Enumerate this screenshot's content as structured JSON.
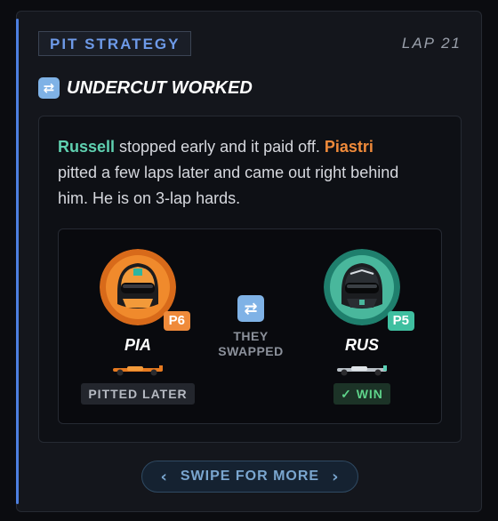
{
  "header": {
    "tag": "PIT STRATEGY",
    "lap": "LAP 21"
  },
  "headline": {
    "icon": "shuffle-icon",
    "glyph": "⇄",
    "text": "UNDERCUT WORKED"
  },
  "story": {
    "driver1": "Russell",
    "text1": " stopped early and it paid off. ",
    "driver2": "Piastri",
    "text2": " pitted a few laps later and came out right behind him. He is on 3-lap hards."
  },
  "swap": {
    "left": {
      "code": "PIA",
      "position": "P6",
      "status": "PITTED LATER",
      "color": "#ef8a3a"
    },
    "middle": {
      "glyph": "⇄",
      "line1": "THEY",
      "line2": "SWAPPED"
    },
    "right": {
      "code": "RUS",
      "position": "P5",
      "check": "✓",
      "status": "WIN",
      "color": "#3fbfa0"
    }
  },
  "footer": {
    "label": "SWIPE FOR MORE",
    "prev": "‹",
    "next": "›"
  }
}
